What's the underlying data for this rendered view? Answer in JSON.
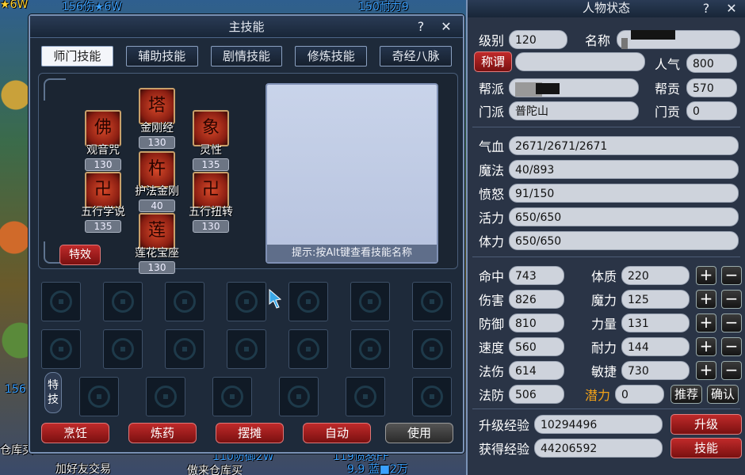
{
  "background": {
    "left_texts": [
      {
        "t": "156伤★6W",
        "cls": "blue"
      },
      {
        "t": "150耐力9",
        "cls": "blue"
      },
      {
        "t": "156",
        "cls": "blue"
      },
      {
        "t": "119愤怒FF",
        "cls": "blue"
      },
      {
        "t": "110防御2W",
        "cls": "blue"
      },
      {
        "t": "加好友交易",
        "cls": ""
      },
      {
        "t": "傲来仓库买",
        "cls": ""
      },
      {
        "t": "9.9 蓝■2万",
        "cls": "blue"
      },
      {
        "t": "仓库买",
        "cls": ""
      },
      {
        "t": "★6W",
        "cls": "yellow"
      }
    ]
  },
  "skill_window": {
    "title": "主技能",
    "help": "?",
    "close": "✕",
    "tabs": [
      "师门技能",
      "辅助技能",
      "剧情技能",
      "修炼技能",
      "奇经八脉"
    ],
    "skills": [
      {
        "name": "观音咒",
        "level": "130",
        "glyph": "佛"
      },
      {
        "name": "金刚经",
        "level": "130",
        "glyph": "塔"
      },
      {
        "name": "灵性",
        "level": "135",
        "glyph": "象"
      },
      {
        "name": "五行学说",
        "level": "135",
        "glyph": "卍"
      },
      {
        "name": "护法金刚",
        "level": "40",
        "glyph": "杵"
      },
      {
        "name": "五行扭转",
        "level": "130",
        "glyph": "卍"
      },
      {
        "name": "莲花宝座",
        "level": "130",
        "glyph": "莲"
      }
    ],
    "effect_button": "特效",
    "hint": "提示:按Alt键查看技能名称",
    "special_label": "特技",
    "bottom_buttons": [
      "烹饪",
      "炼药",
      "摆摊",
      "自动",
      "使用"
    ]
  },
  "status_window": {
    "title": "人物状态",
    "help": "?",
    "close": "✕",
    "basic": {
      "level_label": "级别",
      "level": "120",
      "name_label": "名称",
      "name": "",
      "title_button": "称谓",
      "title_value": "",
      "popularity_label": "人气",
      "popularity": "800",
      "gang_label": "帮派",
      "gang": "",
      "contribution_label": "帮贡",
      "contribution": "570",
      "school_label": "门派",
      "school": "普陀山",
      "school_contrib_label": "门贡",
      "school_contrib": "0"
    },
    "vitals": [
      {
        "label": "气血",
        "value": "2671/2671/2671"
      },
      {
        "label": "魔法",
        "value": "40/893"
      },
      {
        "label": "愤怒",
        "value": "91/150"
      },
      {
        "label": "活力",
        "value": "650/650"
      },
      {
        "label": "体力",
        "value": "650/650"
      }
    ],
    "combat": [
      {
        "label": "命中",
        "value": "743"
      },
      {
        "label": "伤害",
        "value": "826"
      },
      {
        "label": "防御",
        "value": "810"
      },
      {
        "label": "速度",
        "value": "560"
      },
      {
        "label": "法伤",
        "value": "614"
      },
      {
        "label": "法防",
        "value": "506"
      }
    ],
    "attributes": [
      {
        "label": "体质",
        "value": "220"
      },
      {
        "label": "魔力",
        "value": "125"
      },
      {
        "label": "力量",
        "value": "131"
      },
      {
        "label": "耐力",
        "value": "144"
      },
      {
        "label": "敏捷",
        "value": "730"
      }
    ],
    "potential_label": "潜力",
    "potential": "0",
    "recommend_button": "推荐",
    "confirm_button": "确认",
    "upgrade_exp_label": "升级经验",
    "upgrade_exp": "10294496",
    "gained_exp_label": "获得经验",
    "gained_exp": "44206592",
    "upgrade_button": "升级",
    "skills_button": "技能",
    "plus": "+",
    "minus": "−"
  }
}
